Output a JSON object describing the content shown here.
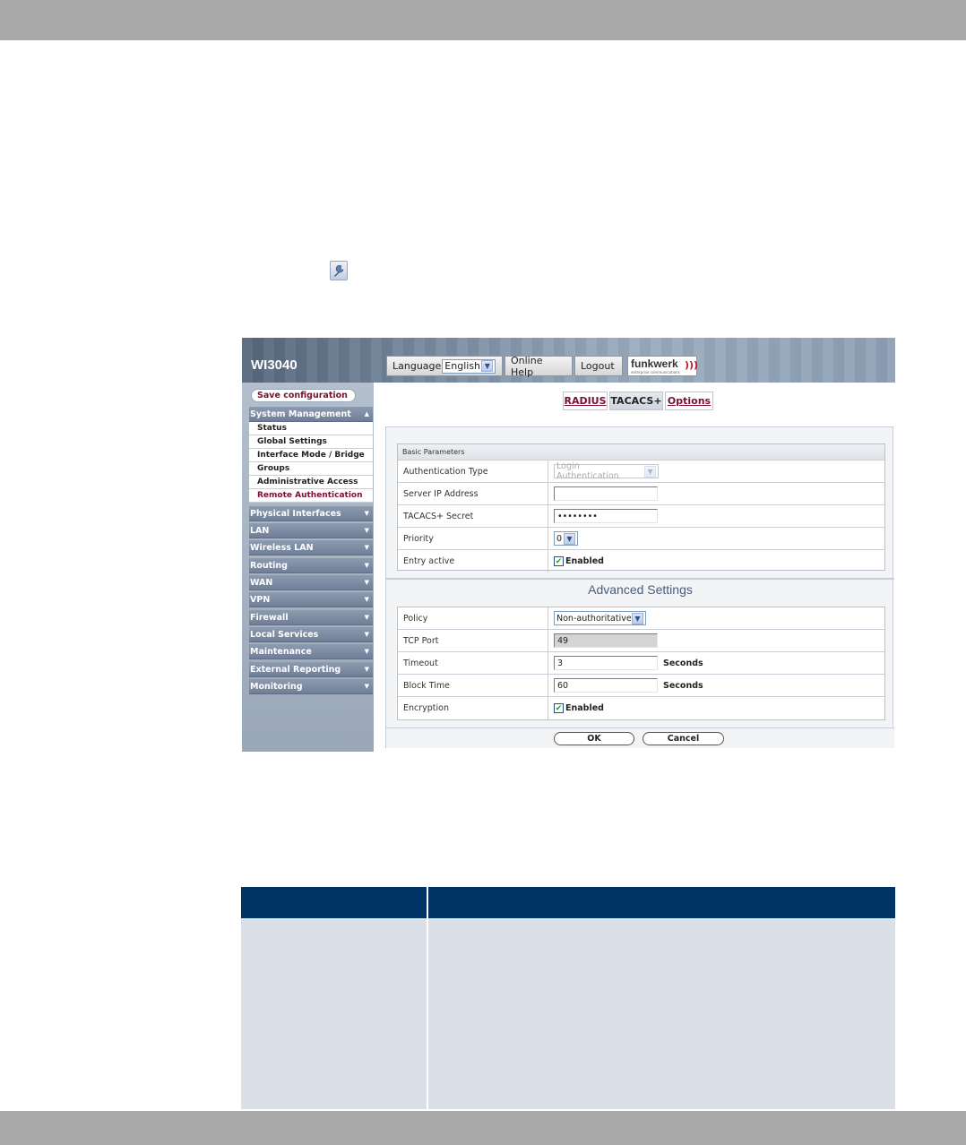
{
  "device": {
    "title": "WI3040"
  },
  "header": {
    "language_label": "Language",
    "language_value": "English",
    "online_help": "Online Help",
    "logout": "Logout",
    "brand": "funkwerk",
    "brand_sub": "enterprise communications"
  },
  "sidebar": {
    "save_label": "Save configuration",
    "groups": [
      {
        "label": "System Management"
      },
      {
        "label": "Physical Interfaces"
      },
      {
        "label": "LAN"
      },
      {
        "label": "Wireless LAN"
      },
      {
        "label": "Routing"
      },
      {
        "label": "WAN"
      },
      {
        "label": "VPN"
      },
      {
        "label": "Firewall"
      },
      {
        "label": "Local Services"
      },
      {
        "label": "Maintenance"
      },
      {
        "label": "External Reporting"
      },
      {
        "label": "Monitoring"
      }
    ],
    "sub_items": [
      {
        "label": "Status"
      },
      {
        "label": "Global Settings"
      },
      {
        "label": "Interface Mode / Bridge"
      },
      {
        "label": "Groups"
      },
      {
        "label": "Administrative Access"
      },
      {
        "label": "Remote Authentication"
      }
    ]
  },
  "tabs": [
    {
      "label": "RADIUS"
    },
    {
      "label": "TACACS+"
    },
    {
      "label": "Options"
    }
  ],
  "basic": {
    "header": "Basic Parameters",
    "auth_type_label": "Authentication Type",
    "auth_type_value": "Login Authentication",
    "server_ip_label": "Server IP Address",
    "server_ip_value": "",
    "secret_label": "TACACS+ Secret",
    "secret_value": "••••••••",
    "priority_label": "Priority",
    "priority_value": "0",
    "entry_active_label": "Entry active",
    "entry_active_check": "Enabled"
  },
  "advanced": {
    "title": "Advanced Settings",
    "policy_label": "Policy",
    "policy_value": "Non-authoritative",
    "tcp_port_label": "TCP Port",
    "tcp_port_value": "49",
    "timeout_label": "Timeout",
    "timeout_value": "3",
    "timeout_unit": "Seconds",
    "block_time_label": "Block Time",
    "block_time_value": "60",
    "block_time_unit": "Seconds",
    "encryption_label": "Encryption",
    "encryption_check": "Enabled"
  },
  "buttons": {
    "ok": "OK",
    "cancel": "Cancel"
  },
  "icons": {
    "wrench": "wrench-icon",
    "checkbox": "checkmark-icon",
    "dropdown": "chevron-down-icon"
  },
  "colors": {
    "table_header": "#003366",
    "table_body": "#dbe0e8",
    "accent_link": "#7a1035"
  }
}
